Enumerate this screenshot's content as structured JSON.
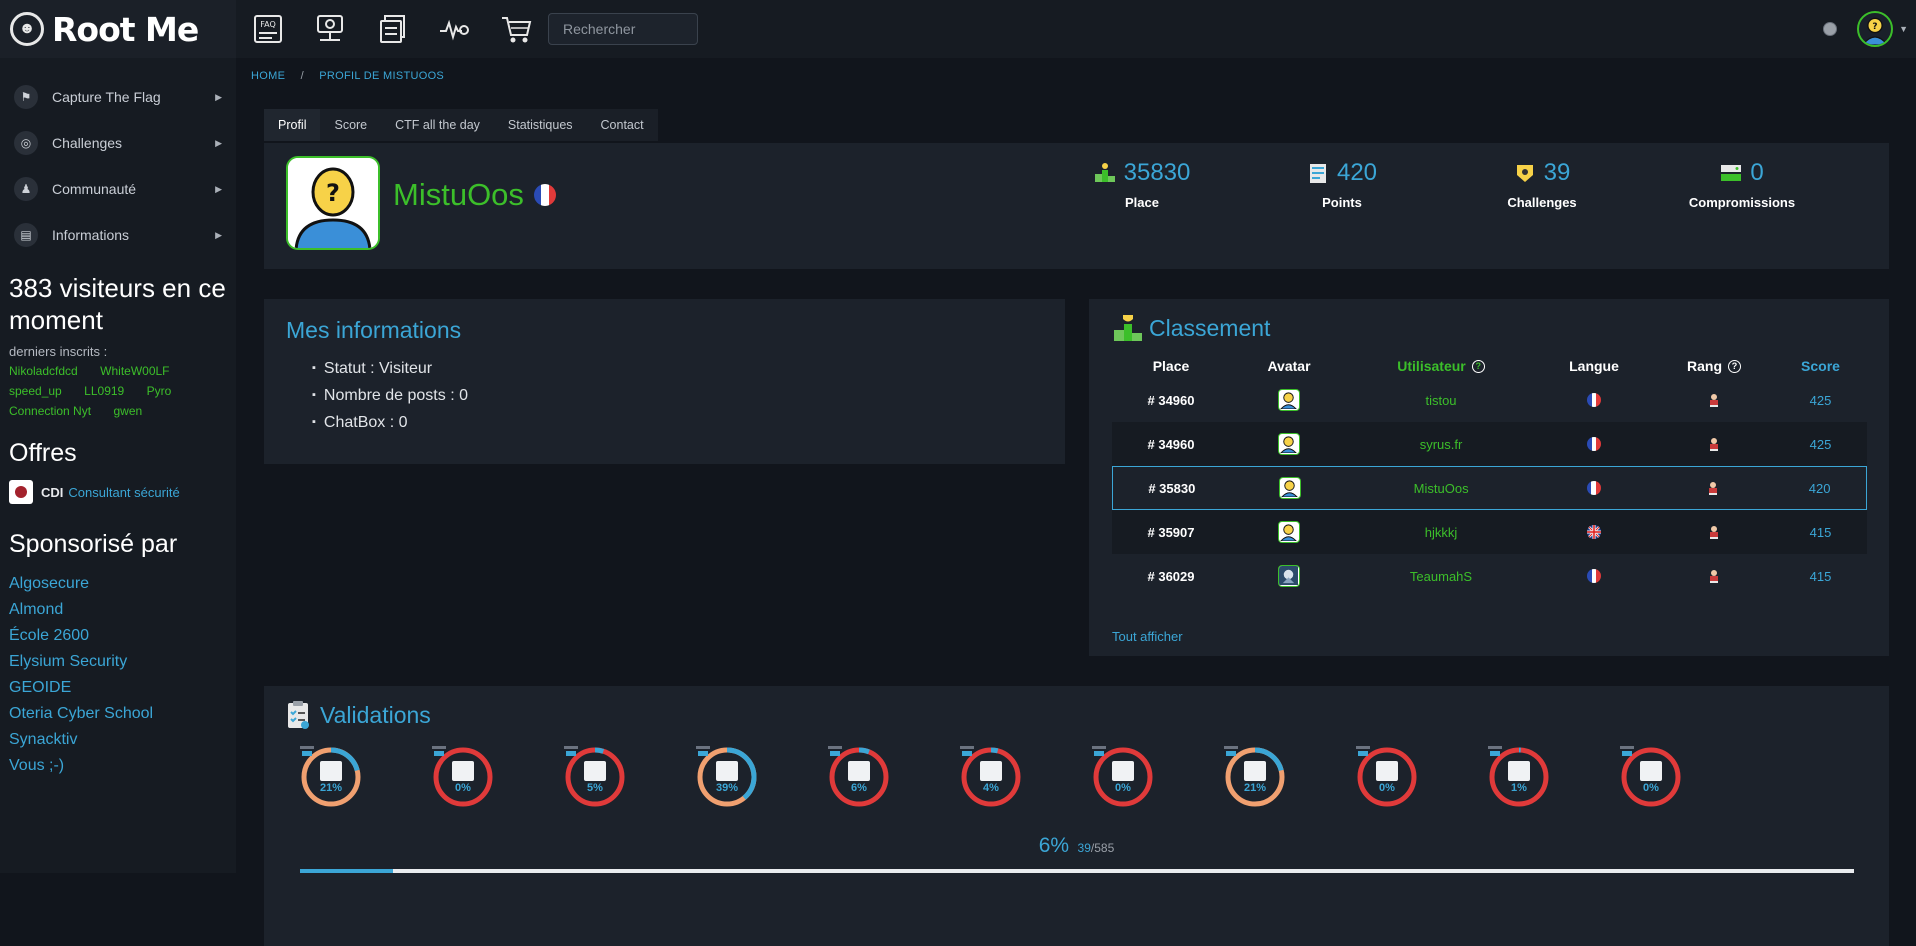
{
  "brand": {
    "name": "Root Me"
  },
  "sidebar": {
    "menu": [
      {
        "label": "Capture The Flag",
        "icon": "flag-icon"
      },
      {
        "label": "Challenges",
        "icon": "target-icon"
      },
      {
        "label": "Communauté",
        "icon": "community-icon"
      },
      {
        "label": "Informations",
        "icon": "info-icon"
      }
    ],
    "visitors": "383 visiteurs en ce moment",
    "derniers_inscrits_label": "derniers inscrits :",
    "derniers_inscrits": [
      "Nikoladcfdcd",
      "WhiteW00LF",
      "speed_up",
      "LL0919",
      "Pyro",
      "Connection Nyt",
      "gwen"
    ],
    "offres_title": "Offres",
    "offer": {
      "type": "CDI",
      "title": "Consultant sécurité"
    },
    "sponsors_title": "Sponsorisé par",
    "sponsors": [
      "Algosecure",
      "Almond",
      "École 2600",
      "Elysium Security",
      "GEOIDE",
      "Oteria Cyber School",
      "Synacktiv",
      "Vous ;-)"
    ]
  },
  "topbar": {
    "icons": [
      "faq-icon",
      "network-icon",
      "documents-icon",
      "radar-icon",
      "cart-icon"
    ],
    "search_placeholder": "Rechercher"
  },
  "breadcrumb": {
    "home": "HOME",
    "separator": "/",
    "current": "PROFIL DE MISTUOOS"
  },
  "tabs": [
    "Profil",
    "Score",
    "CTF all the day",
    "Statistiques",
    "Contact"
  ],
  "active_tab": "Profil",
  "profile": {
    "name": "MistuOos",
    "stats": [
      {
        "value": "35830",
        "label": "Place"
      },
      {
        "value": "420",
        "label": "Points"
      },
      {
        "value": "39",
        "label": "Challenges"
      },
      {
        "value": "0",
        "label": "Compromissions"
      }
    ]
  },
  "mes_informations": {
    "title": "Mes informations",
    "items": [
      "Statut : Visiteur",
      "Nombre de posts : 0",
      "ChatBox : 0"
    ]
  },
  "classement": {
    "title": "Classement",
    "headers": {
      "place": "Place",
      "avatar": "Avatar",
      "utilisateur": "Utilisateur",
      "langue": "Langue",
      "rang": "Rang",
      "score": "Score"
    },
    "rows": [
      {
        "place": "# 34960",
        "user": "tistou",
        "lang": "fr",
        "score": "425"
      },
      {
        "place": "# 34960",
        "user": "syrus.fr",
        "lang": "fr",
        "score": "425"
      },
      {
        "place": "# 35830",
        "user": "MistuOos",
        "lang": "fr",
        "score": "420"
      },
      {
        "place": "# 35907",
        "user": "hjkkkj",
        "lang": "gb",
        "score": "415"
      },
      {
        "place": "# 36029",
        "user": "TeaumahS",
        "lang": "fr",
        "score": "415"
      }
    ],
    "tout_afficher": "Tout afficher"
  },
  "validations": {
    "title": "Validations",
    "categories": [
      {
        "pct": "21%",
        "value": 0.21,
        "icon": "web-client-icon"
      },
      {
        "pct": "0%",
        "value": 0.0,
        "icon": "app-script-icon"
      },
      {
        "pct": "5%",
        "value": 0.05,
        "icon": "cryptanalyse-icon"
      },
      {
        "pct": "39%",
        "value": 0.39,
        "icon": "forensic-icon"
      },
      {
        "pct": "6%",
        "value": 0.06,
        "icon": "network-cloud-icon"
      },
      {
        "pct": "4%",
        "value": 0.04,
        "icon": "realist-icon"
      },
      {
        "pct": "0%",
        "value": 0.0,
        "icon": "app-system-icon"
      },
      {
        "pct": "21%",
        "value": 0.21,
        "icon": "web-server-icon"
      },
      {
        "pct": "0%",
        "value": 0.0,
        "icon": "programmation-icon"
      },
      {
        "pct": "1%",
        "value": 0.01,
        "icon": "cracking-icon"
      },
      {
        "pct": "0%",
        "value": 0.0,
        "icon": "steganographie-icon"
      }
    ],
    "total_pct": "6%",
    "total_count": "39",
    "total_sep": "/585",
    "total_value": 0.06
  },
  "colors": {
    "accent": "#3ba6d6",
    "green": "#3cbf2a",
    "ring_low": "#e03a3a",
    "ring_mid": "#f0a070"
  }
}
